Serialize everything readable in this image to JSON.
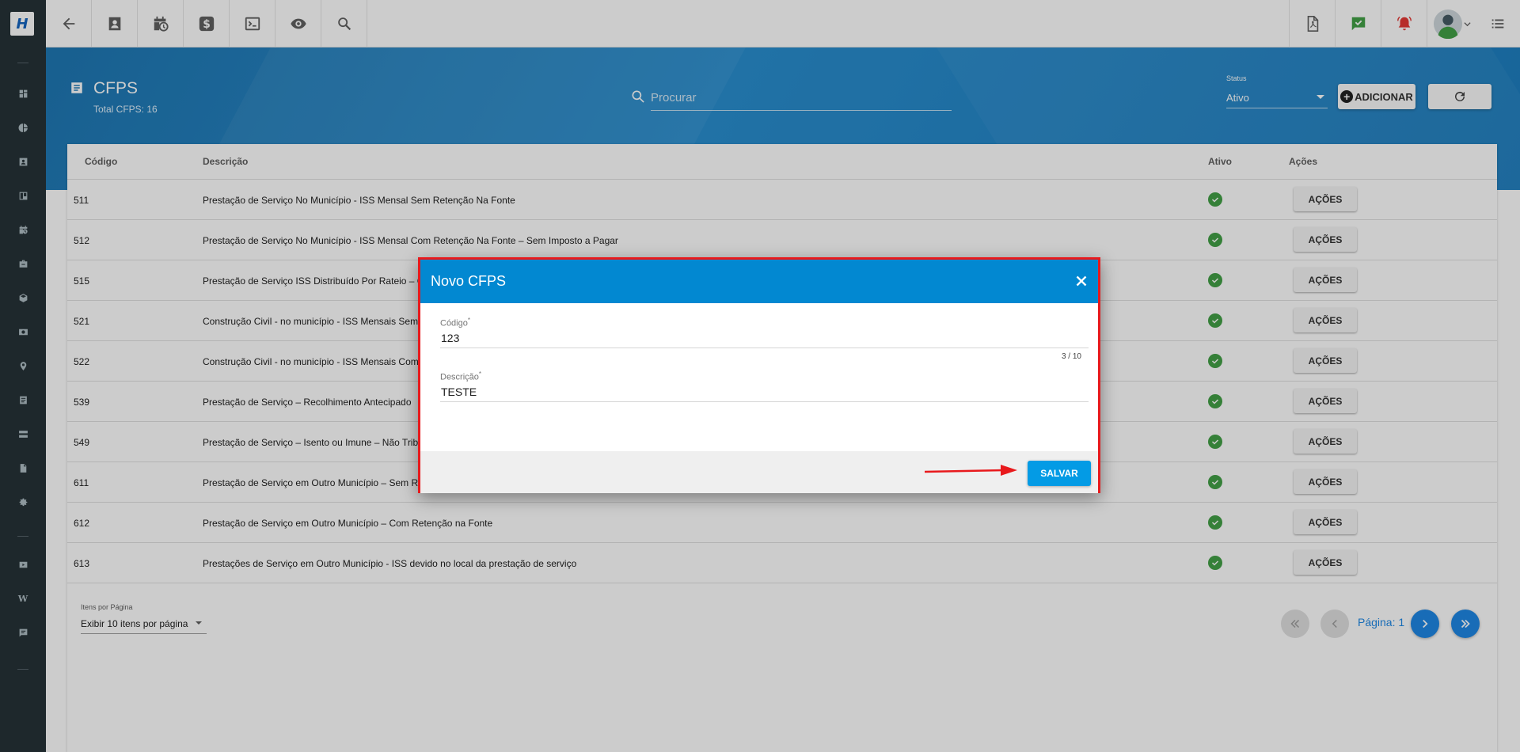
{
  "topbar": {
    "left_icons": [
      "back-arrow-icon",
      "contact-card-icon",
      "calendar-clock-icon",
      "dollar-icon",
      "terminal-icon",
      "eye-icon",
      "search-icon"
    ],
    "right_icons": [
      "pdf-document-icon",
      "checked-message-icon",
      "alarm-bell-icon",
      "user-avatar",
      "menu-list-icon"
    ],
    "accent_colors": {
      "check": "#43a047",
      "alarm": "#e53935"
    }
  },
  "sidebar": {
    "items": [
      "dashboard-icon",
      "pie-chart-icon",
      "contact-icon",
      "board-icon",
      "calendar-clock-icon",
      "briefcase-icon",
      "box-icon",
      "money-icon",
      "location-icon",
      "list-icon",
      "server-icon",
      "document-icon",
      "settings-icon",
      "video-icon",
      "wiki-icon",
      "chat-icon"
    ],
    "wiki_glyph": "W"
  },
  "header": {
    "title": "CFPS",
    "subtitle": "Total CFPS: 16",
    "search_placeholder": "Procurar",
    "status_label": "Status",
    "status_value": "Ativo",
    "add_label": "ADICIONAR"
  },
  "table": {
    "columns": {
      "code": "Código",
      "description": "Descrição",
      "active": "Ativo",
      "actions": "Ações"
    },
    "action_label": "AÇÕES",
    "rows": [
      {
        "code": "511",
        "description": "Prestação de Serviço No Município - ISS Mensal Sem Retenção Na Fonte"
      },
      {
        "code": "512",
        "description": "Prestação de Serviço No Município - ISS Mensal Com Retenção Na Fonte – Sem Imposto a Pagar"
      },
      {
        "code": "515",
        "description": "Prestação de Serviço ISS Distribuído Por Rateio – Com"
      },
      {
        "code": "521",
        "description": "Construção Civil - no município - ISS Mensais Sem Re"
      },
      {
        "code": "522",
        "description": "Construção Civil - no município - ISS Mensais Com Re"
      },
      {
        "code": "539",
        "description": "Prestação de Serviço – Recolhimento Antecipado"
      },
      {
        "code": "549",
        "description": "Prestação de Serviço – Isento ou Imune – Não Tribut"
      },
      {
        "code": "611",
        "description": "Prestação de Serviço em Outro Município – Sem Rete"
      },
      {
        "code": "612",
        "description": "Prestação de Serviço em Outro Município – Com Retenção na Fonte"
      },
      {
        "code": "613",
        "description": "Prestações de Serviço em Outro Município - ISS devido no local da prestação de serviço"
      }
    ]
  },
  "pagination": {
    "items_per_page_label": "Itens por Página",
    "items_per_page_value": "Exibir 10 itens por página",
    "page_label": "Página: 1"
  },
  "modal": {
    "title": "Novo CFPS",
    "codigo_label": "Código",
    "codigo_value": "123",
    "codigo_counter": "3 / 10",
    "descricao_label": "Descrição",
    "descricao_value": "TESTE",
    "required_mark": "*",
    "save_label": "SALVAR"
  }
}
